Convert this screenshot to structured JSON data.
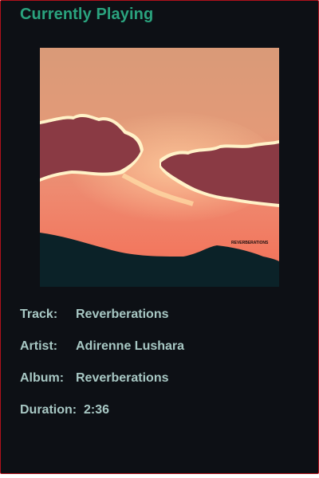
{
  "header": {
    "title": "Currently Playing"
  },
  "album_art": {
    "text": "REVERBERATIONS"
  },
  "details": {
    "track_label": "Track:",
    "track_value": "Reverberations",
    "artist_label": "Artist:",
    "artist_value": "Adirenne Lushara",
    "album_label": "Album:",
    "album_value": "Reverberations",
    "duration_label": "Duration:",
    "duration_value": "2:36"
  },
  "colors": {
    "accent": "#2aa37e",
    "text": "#a8c8c4",
    "background": "#0d1015",
    "border": "#b0121c"
  }
}
